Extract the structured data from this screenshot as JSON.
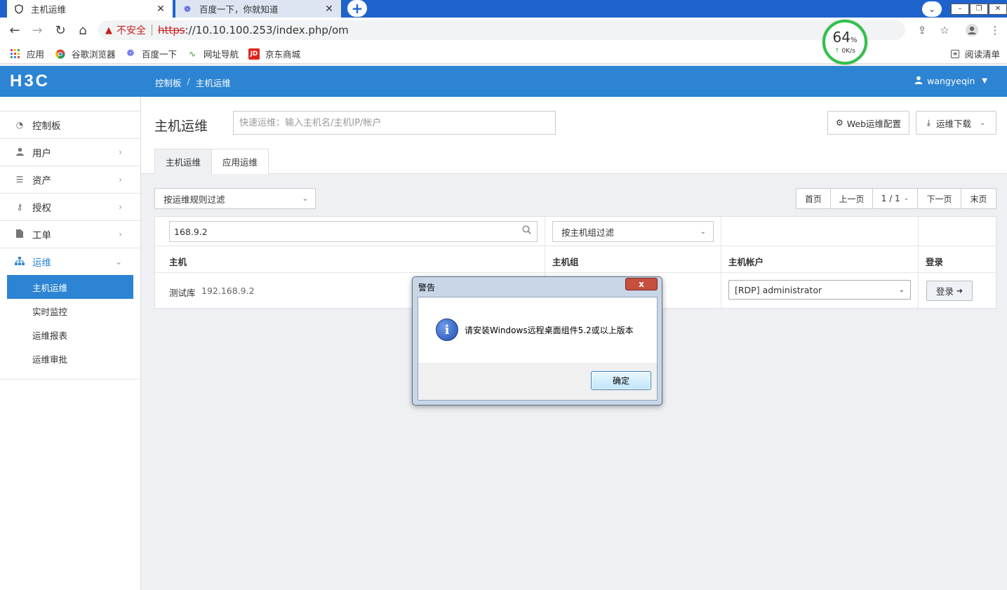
{
  "browser": {
    "tabs": [
      {
        "title": "主机运维",
        "active": true
      },
      {
        "title": "百度一下，你就知道",
        "active": false
      }
    ],
    "new_tab_label": "+",
    "address": {
      "warning_label": "不安全",
      "url_scheme": "https",
      "url_rest": "://10.10.100.253/index.php/om"
    },
    "bookmarks": [
      {
        "label": "应用",
        "icon": "apps-grid-icon"
      },
      {
        "label": "谷歌浏览器",
        "icon": "chrome-icon"
      },
      {
        "label": "百度一下",
        "icon": "baidu-paw-icon"
      },
      {
        "label": "网址导航",
        "icon": "2345-nav-icon"
      },
      {
        "label": "京东商城",
        "icon": "jd-icon"
      }
    ],
    "reading_list": "阅读清单",
    "speed_widget": {
      "percent": "64",
      "percent_sign": "%",
      "rate": "0K/s"
    }
  },
  "app": {
    "logo": "H3C",
    "breadcrumb": [
      "控制板",
      "主机运维"
    ],
    "breadcrumb_sep": "/",
    "user": "wangyeqin",
    "accent": "#2c84d2"
  },
  "sidebar": {
    "items": [
      {
        "label": "控制板",
        "icon": "dashboard-icon",
        "arrow": ""
      },
      {
        "label": "用户",
        "icon": "user-icon",
        "arrow": "›"
      },
      {
        "label": "资产",
        "icon": "list-icon",
        "arrow": "›"
      },
      {
        "label": "授权",
        "icon": "key-icon",
        "arrow": "›"
      },
      {
        "label": "工单",
        "icon": "file-icon",
        "arrow": "›"
      },
      {
        "label": "运维",
        "icon": "sitemap-icon",
        "arrow": "⌄"
      }
    ],
    "sub_items": [
      {
        "label": "主机运维",
        "active": true
      },
      {
        "label": "实时监控",
        "active": false
      },
      {
        "label": "运维报表",
        "active": false
      },
      {
        "label": "运维审批",
        "active": false
      }
    ]
  },
  "main": {
    "title": "主机运维",
    "quick_search_placeholder": "快速运维：输入主机名/主机IP/帐户",
    "web_config_button": "Web运维配置",
    "download_button": "运维下载",
    "tabs": [
      "主机运维",
      "应用运维"
    ],
    "rule_filter": "按运维规则过滤",
    "pager": [
      "首页",
      "上一页",
      "1 / 1",
      "下一页",
      "末页"
    ],
    "search_value": "168.9.2",
    "group_filter": "按主机组过滤",
    "columns": [
      "主机",
      "主机组",
      "主机帐户",
      "登录"
    ],
    "rows": [
      {
        "host_name": "测试库",
        "host_ip": "192.168.9.2",
        "account": "[RDP] administrator",
        "login": "登录"
      }
    ]
  },
  "dialog": {
    "title": "警告",
    "close_label": "x",
    "message": "请安装Windows远程桌面组件5.2或以上版本",
    "ok_label": "确定"
  }
}
